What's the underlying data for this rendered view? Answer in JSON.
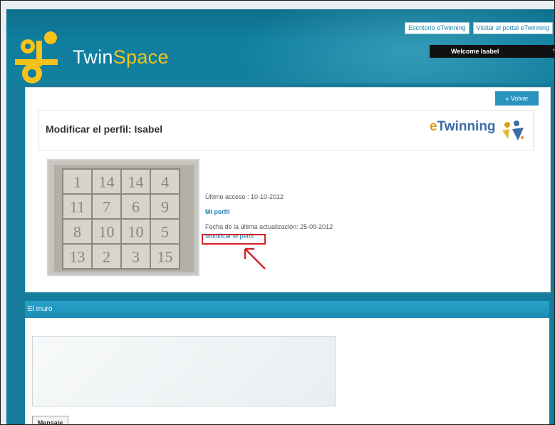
{
  "header": {
    "links": [
      "Escritorio eTwinning",
      "Visitar el portal eTwinning"
    ],
    "brand_main": "Twin",
    "brand_accent": "Space",
    "welcome": "Welcome Isabel",
    "colors": {
      "header_bg": "#0f7e9e",
      "accent": "#f7c319"
    }
  },
  "content": {
    "back_button": "« Volver",
    "title": "Modificar el perfil: Isabel",
    "logo_text": "Twinning",
    "logo_text_prefix": "e",
    "photo_numbers": [
      [
        "1",
        "14",
        "14",
        "4"
      ],
      [
        "11",
        "7",
        "6",
        "9"
      ],
      [
        "8",
        "10",
        "10",
        "5"
      ],
      [
        "13",
        "2",
        "3",
        "15"
      ]
    ],
    "last_access": "Último acceso : 10-10-2012",
    "my_profile": "Mi perfil",
    "last_update": "Fecha de la última actualización: 25-09-2012",
    "edit_profile": "Modificar el perfil"
  },
  "wall": {
    "title": "El muro",
    "message_button": "Mensaje"
  }
}
